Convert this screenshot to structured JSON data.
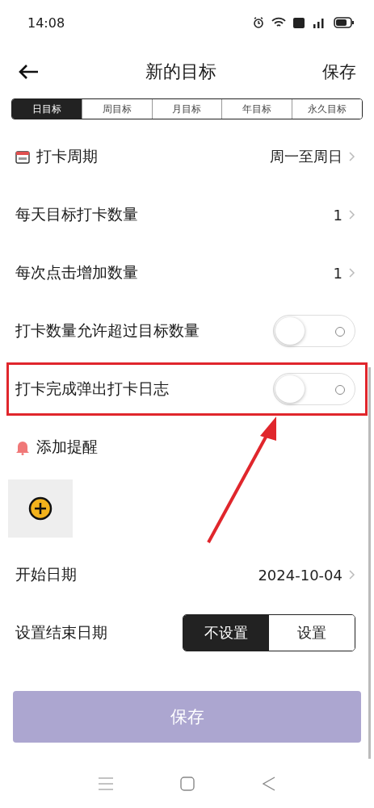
{
  "status_bar": {
    "time": "14:08"
  },
  "header": {
    "title": "新的目标",
    "action": "保存"
  },
  "tabs": [
    {
      "label": "日目标",
      "selected": true
    },
    {
      "label": "周目标",
      "selected": false
    },
    {
      "label": "月目标",
      "selected": false
    },
    {
      "label": "年目标",
      "selected": false
    },
    {
      "label": "永久目标",
      "selected": false
    }
  ],
  "settings": [
    {
      "kind": "value",
      "label": "打卡周期",
      "value": "周一至周日",
      "highlighted": false
    },
    {
      "kind": "value",
      "label": "每天目标打卡数量",
      "value": "1",
      "highlighted": false
    },
    {
      "kind": "value",
      "label": "每次点击增加数量",
      "value": "1",
      "highlighted": false
    },
    {
      "kind": "toggle",
      "label": "打卡数量允许超过目标数量",
      "on": false,
      "highlighted": false
    },
    {
      "kind": "toggle",
      "label": "打卡完成弹出打卡日志",
      "on": false,
      "highlighted": true
    }
  ],
  "reminder": {
    "label": "添加提醒"
  },
  "start_date": {
    "label": "开始日期",
    "value": "2024-10-04"
  },
  "end_date": {
    "label": "设置结束日期",
    "options": [
      {
        "label": "不设置",
        "selected": true
      },
      {
        "label": "设置",
        "selected": false
      }
    ]
  },
  "save_button": "保存"
}
